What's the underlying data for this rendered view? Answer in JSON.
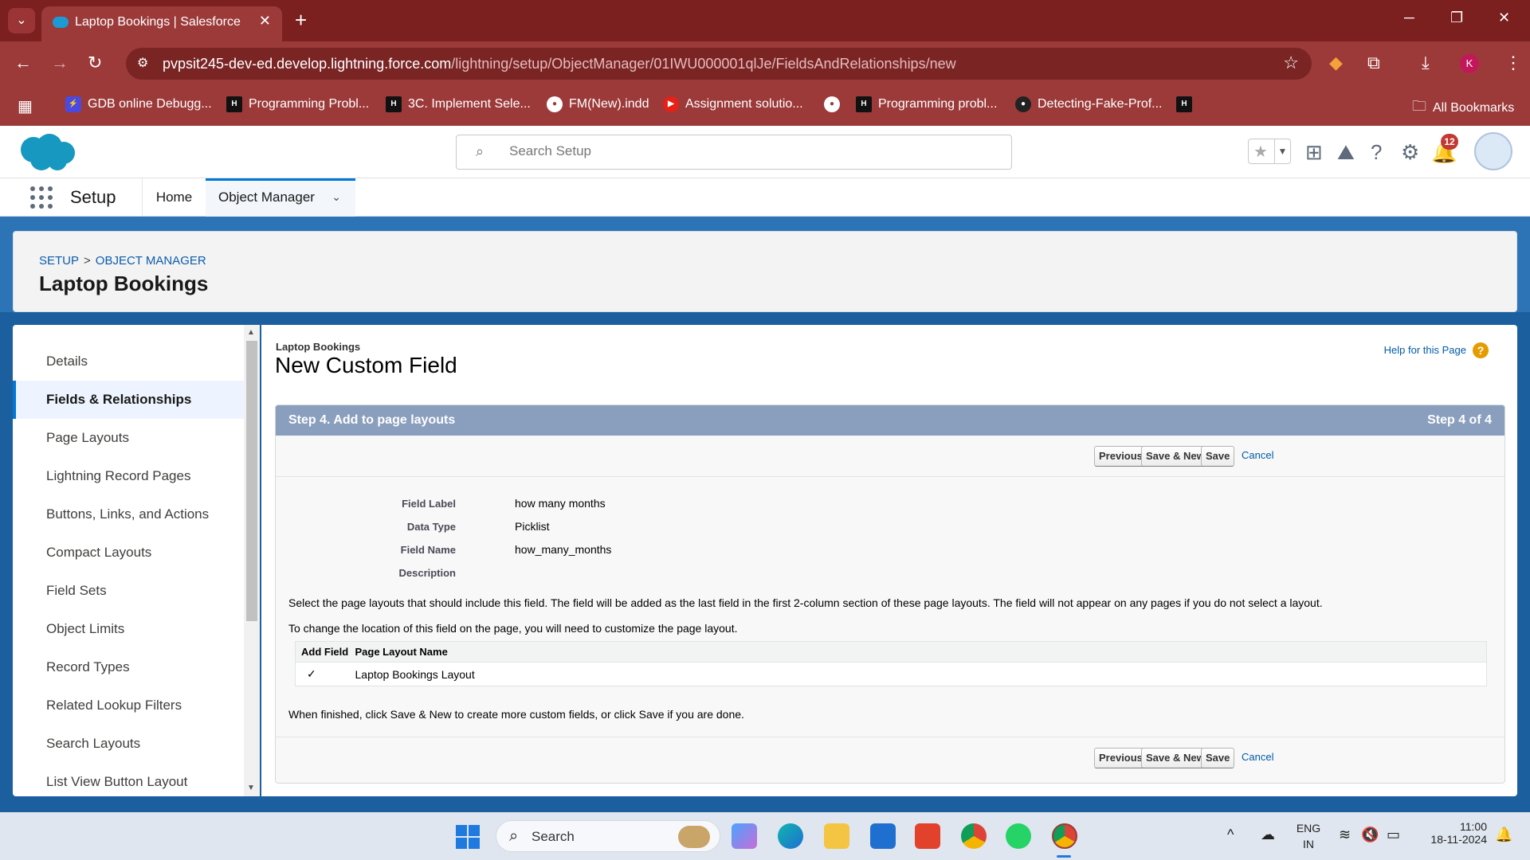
{
  "browser": {
    "tab_title": "Laptop Bookings | Salesforce",
    "tab_close": "✕",
    "new_tab": "+",
    "url_host": "pvpsit245-dev-ed.develop.lightning.force.com",
    "url_path": "/lightning/setup/ObjectManager/01IWU000001qlJe/FieldsAndRelationships/new",
    "profile_initial": "K",
    "bookmarks": [
      {
        "label": "GDB online Debugg..."
      },
      {
        "label": "Programming Probl..."
      },
      {
        "label": "3C. Implement Sele..."
      },
      {
        "label": "FM(New).indd"
      },
      {
        "label": "Assignment solutio..."
      },
      {
        "label": "Programming probl..."
      },
      {
        "label": "Detecting-Fake-Prof..."
      }
    ],
    "all_bookmarks": "All Bookmarks"
  },
  "sf": {
    "search_placeholder": "Search Setup",
    "notification_count": "12",
    "app_name": "Setup",
    "nav_home": "Home",
    "nav_object_manager": "Object Manager",
    "breadcrumb_setup": "SETUP",
    "breadcrumb_sep": ">",
    "breadcrumb_object_manager": "OBJECT MANAGER",
    "page_title": "Laptop Bookings"
  },
  "sidebar": {
    "items": [
      {
        "label": "Details"
      },
      {
        "label": "Fields & Relationships"
      },
      {
        "label": "Page Layouts"
      },
      {
        "label": "Lightning Record Pages"
      },
      {
        "label": "Buttons, Links, and Actions"
      },
      {
        "label": "Compact Layouts"
      },
      {
        "label": "Field Sets"
      },
      {
        "label": "Object Limits"
      },
      {
        "label": "Record Types"
      },
      {
        "label": "Related Lookup Filters"
      },
      {
        "label": "Search Layouts"
      },
      {
        "label": "List View Button Layout"
      }
    ]
  },
  "main": {
    "object_name": "Laptop Bookings",
    "title": "New Custom Field",
    "help_link": "Help for this Page",
    "step_title": "Step 4. Add to page layouts",
    "step_counter": "Step 4 of 4",
    "buttons": {
      "previous": "Previous",
      "save_new": "Save & New",
      "save": "Save",
      "cancel": "Cancel"
    },
    "details": {
      "field_label_lbl": "Field Label",
      "field_label_val": "how many months",
      "data_type_lbl": "Data Type",
      "data_type_val": "Picklist",
      "field_name_lbl": "Field Name",
      "field_name_val": "how_many_months",
      "description_lbl": "Description"
    },
    "instruction_1": "Select the page layouts that should include this field. The field will be added as the last field in the first 2-column section of these page layouts. The field will not appear on any pages if you do not select a layout.",
    "instruction_2": "To change the location of this field on the page, you will need to customize the page layout.",
    "table": {
      "col_add": "Add Field",
      "col_name": "Page Layout Name",
      "rows": [
        {
          "check": "✓",
          "name": "Laptop Bookings Layout"
        }
      ]
    },
    "finish_note": "When finished, click Save & New to create more custom fields, or click Save if you are done."
  },
  "taskbar": {
    "search": "Search",
    "lang": "ENG",
    "region": "IN",
    "time": "11:00",
    "date": "18-11-2024"
  }
}
